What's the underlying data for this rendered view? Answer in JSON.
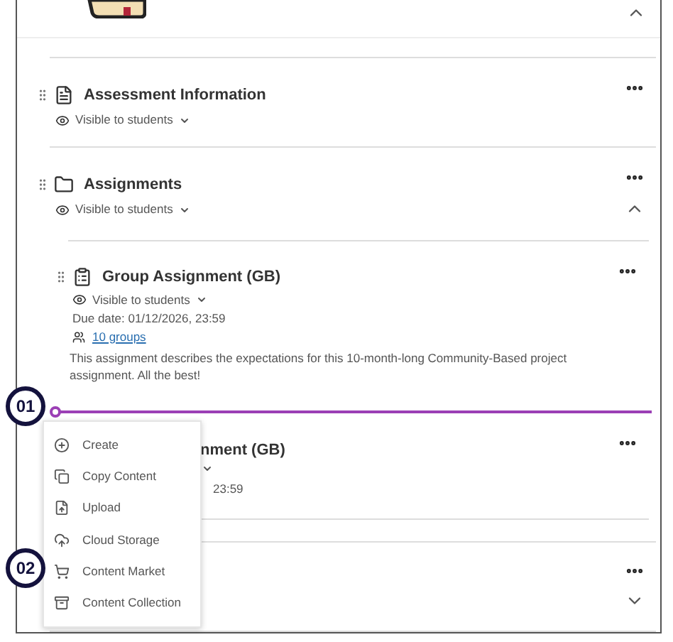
{
  "top_section": {
    "expanded": true
  },
  "items": [
    {
      "kind": "document",
      "title": "Assessment Information",
      "visibility": "Visible to students"
    },
    {
      "kind": "folder",
      "title": "Assignments",
      "visibility": "Visible to students",
      "expanded": true,
      "children": [
        {
          "kind": "assignment",
          "title": "Group Assignment (GB)",
          "visibility": "Visible to students",
          "due": "Due date: 01/12/2026, 23:59",
          "groups": "10 groups",
          "description": "This assignment describes the expectations for this 10-month-long Community-Based project assignment. All the best!"
        },
        {
          "title": "nment (GB)",
          "due": "23:59"
        }
      ]
    },
    {
      "expanded": false
    }
  ],
  "add_menu": {
    "items": [
      {
        "kind": "create",
        "label": "Create"
      },
      {
        "kind": "copy",
        "label": "Copy Content"
      },
      {
        "kind": "upload",
        "label": "Upload"
      },
      {
        "kind": "cloud",
        "label": "Cloud Storage"
      },
      {
        "kind": "market",
        "label": "Content Market"
      },
      {
        "kind": "collection",
        "label": "Content Collection"
      }
    ]
  },
  "callouts": [
    "01",
    "02"
  ]
}
